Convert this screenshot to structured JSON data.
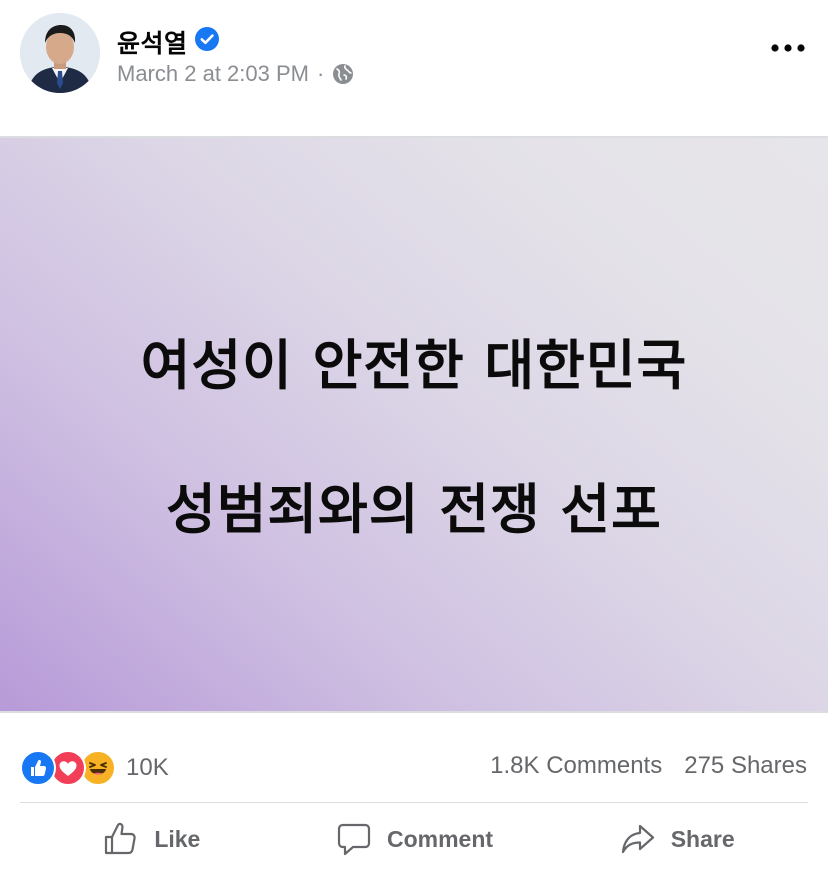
{
  "post": {
    "author": "윤석열",
    "verified_icon": "verified-badge-icon",
    "timestamp": "March 2 at 2:03 PM",
    "separator": "·",
    "audience_icon": "globe-icon",
    "more_icon": "more-options-icon",
    "media": {
      "line1": "여성이 안전한 대한민국",
      "line2": "성범죄와의 전쟁 선포"
    },
    "reactions": {
      "icons": [
        "like-reaction-icon",
        "love-reaction-icon",
        "haha-reaction-icon"
      ],
      "count": "10K"
    },
    "comments": "1.8K Comments",
    "shares": "275 Shares",
    "actions": {
      "like": "Like",
      "comment": "Comment",
      "share": "Share"
    }
  },
  "colors": {
    "accent": "#1877f2",
    "secondary_text": "#65676b",
    "meta_text": "#8a8d91",
    "love": "#f33e58",
    "haha": "#f7b125"
  }
}
